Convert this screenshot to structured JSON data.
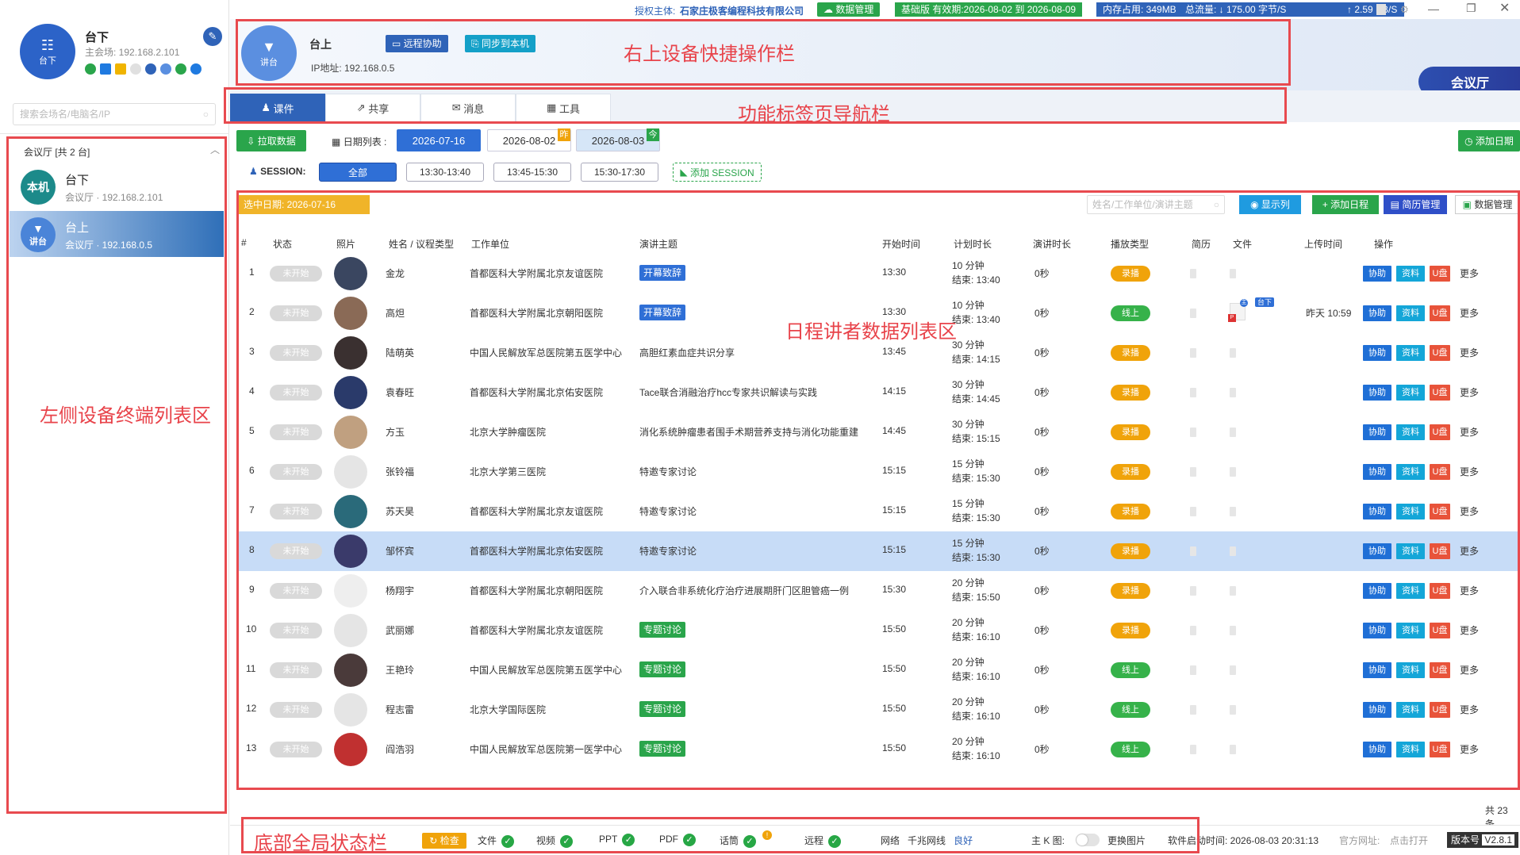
{
  "topbar": {
    "license_label": "授权主体:",
    "license_company": "石家庄极客编程科技有限公司",
    "data_mgmt": "数据管理",
    "edition": "基础版 有效期:2026-08-02 到 2026-08-09",
    "memory": "内存占用:   349MB",
    "traffic": "总流量:  ↓ 175.00 字节/S",
    "upload": "↑ 2.59 KB/S"
  },
  "left": {
    "host_name": "台下",
    "host_avatar_label": "台下",
    "host_sub": "主会场: 192.168.2.101",
    "search_placeholder": "搜索会场名/电脑名/IP",
    "group_title": "会议厅  [共 2 台]",
    "devices": [
      {
        "avatar": "本机",
        "name": "台下",
        "sub": "会议厅 · 192.168.2.101"
      },
      {
        "avatar": "讲台",
        "name": "台上",
        "sub": "会议厅 · 192.168.0.5"
      }
    ]
  },
  "header": {
    "device_avatar": "讲台",
    "device_name": "台上",
    "ip": "IP地址: 192.168.0.5",
    "remote_btn": "远程协助",
    "sync_btn": "同步到本机",
    "room_btn": "会议厅"
  },
  "tabs": [
    "课件",
    "共享",
    "消息",
    "工具"
  ],
  "daterow": {
    "pull_btn": "拉取数据",
    "date_list_label": "日期列表 :",
    "dates": [
      "2026-07-16",
      "2026-08-02",
      "2026-08-03"
    ],
    "date_badge_yesterday": "昨",
    "date_badge_today": "今",
    "add_date": "添加日期"
  },
  "session": {
    "label": "SESSION:",
    "chips": [
      "全部",
      "13:30-13:40",
      "13:45-15:30",
      "15:30-17:30"
    ],
    "add": "添加 SESSION"
  },
  "toolbar": {
    "selected_date": "选中日期:  2026-07-16",
    "search_placeholder": "姓名/工作单位/演讲主题",
    "show_cols": "显示列",
    "add_schedule": "添加日程",
    "resume_mgmt": "简历管理",
    "data_mgmt": "数据管理"
  },
  "table": {
    "headers": [
      "#",
      "状态",
      "照片",
      "姓名 / 议程类型",
      "工作单位",
      "演讲主题",
      "开始时间",
      "计划时长",
      "演讲时长",
      "播放类型",
      "简历",
      "文件",
      "上传时间",
      "操作"
    ],
    "rows": [
      {
        "n": "1",
        "status": "未开始",
        "name": "金龙",
        "org": "首都医科大学附属北京友谊医院",
        "topic": "开幕致辞",
        "topic_tag": true,
        "start": "13:30",
        "dur": "10 分钟",
        "end": "结束: 13:40",
        "speak": "0秒",
        "play": "录播",
        "play_color": "#f0a30a",
        "upload": ""
      },
      {
        "n": "2",
        "status": "未开始",
        "name": "高炟",
        "org": "首都医科大学附属北京朝阳医院",
        "topic": "开幕致辞",
        "topic_tag": true,
        "start": "13:30",
        "dur": "10 分钟",
        "end": "结束: 13:40",
        "speak": "0秒",
        "play": "线上",
        "play_color": "#36b24a",
        "upload": "昨天 10:59"
      },
      {
        "n": "3",
        "status": "未开始",
        "name": "陆萌英",
        "org": "中国人民解放军总医院第五医学中心",
        "topic": "高胆红素血症共识分享",
        "topic_tag": false,
        "start": "13:45",
        "dur": "30 分钟",
        "end": "结束: 14:15",
        "speak": "0秒",
        "play": "录播",
        "play_color": "#f0a30a",
        "upload": ""
      },
      {
        "n": "4",
        "status": "未开始",
        "name": "袁春旺",
        "org": "首都医科大学附属北京佑安医院",
        "topic": "Tace联合消融治疗hcc专家共识解读与实践",
        "topic_tag": false,
        "start": "14:15",
        "dur": "30 分钟",
        "end": "结束: 14:45",
        "speak": "0秒",
        "play": "录播",
        "play_color": "#f0a30a",
        "upload": ""
      },
      {
        "n": "5",
        "status": "未开始",
        "name": "方玉",
        "org": "北京大学肿瘤医院",
        "topic": "消化系统肿瘤患者围手术期营养支持与消化功能重建",
        "topic_tag": false,
        "start": "14:45",
        "dur": "30 分钟",
        "end": "结束: 15:15",
        "speak": "0秒",
        "play": "录播",
        "play_color": "#f0a30a",
        "upload": ""
      },
      {
        "n": "6",
        "status": "未开始",
        "name": "张铃福",
        "org": "北京大学第三医院",
        "topic": "特邀专家讨论",
        "topic_tag": false,
        "start": "15:15",
        "dur": "15 分钟",
        "end": "结束: 15:30",
        "speak": "0秒",
        "play": "录播",
        "play_color": "#f0a30a",
        "upload": ""
      },
      {
        "n": "7",
        "status": "未开始",
        "name": "苏天昊",
        "org": "首都医科大学附属北京友谊医院",
        "topic": "特邀专家讨论",
        "topic_tag": false,
        "start": "15:15",
        "dur": "15 分钟",
        "end": "结束: 15:30",
        "speak": "0秒",
        "play": "录播",
        "play_color": "#f0a30a",
        "upload": ""
      },
      {
        "n": "8",
        "status": "未开始",
        "name": "邹怀宾",
        "org": "首都医科大学附属北京佑安医院",
        "topic": "特邀专家讨论",
        "topic_tag": false,
        "start": "15:15",
        "dur": "15 分钟",
        "end": "结束: 15:30",
        "speak": "0秒",
        "play": "录播",
        "play_color": "#f0a30a",
        "upload": ""
      },
      {
        "n": "9",
        "status": "未开始",
        "name": "杨翔宇",
        "org": "首都医科大学附属北京朝阳医院",
        "topic": "介入联合非系统化疗治疗进展期肝门区胆管癌一例",
        "topic_tag": false,
        "start": "15:30",
        "dur": "20 分钟",
        "end": "结束: 15:50",
        "speak": "0秒",
        "play": "录播",
        "play_color": "#f0a30a",
        "upload": ""
      },
      {
        "n": "10",
        "status": "未开始",
        "name": "武丽娜",
        "org": "首都医科大学附属北京友谊医院",
        "topic": "专题讨论",
        "topic_tag": true,
        "start": "15:50",
        "dur": "20 分钟",
        "end": "结束: 16:10",
        "speak": "0秒",
        "play": "录播",
        "play_color": "#f0a30a",
        "upload": ""
      },
      {
        "n": "11",
        "status": "未开始",
        "name": "王艳玲",
        "org": "中国人民解放军总医院第五医学中心",
        "topic": "专题讨论",
        "topic_tag": true,
        "start": "15:50",
        "dur": "20 分钟",
        "end": "结束: 16:10",
        "speak": "0秒",
        "play": "线上",
        "play_color": "#36b24a",
        "upload": ""
      },
      {
        "n": "12",
        "status": "未开始",
        "name": "程志雷",
        "org": "北京大学国际医院",
        "topic": "专题讨论",
        "topic_tag": true,
        "start": "15:50",
        "dur": "20 分钟",
        "end": "结束: 16:10",
        "speak": "0秒",
        "play": "线上",
        "play_color": "#36b24a",
        "upload": ""
      },
      {
        "n": "13",
        "status": "未开始",
        "name": "阎浩羽",
        "org": "中国人民解放军总医院第一医学中心",
        "topic": "专题讨论",
        "topic_tag": true,
        "start": "15:50",
        "dur": "20 分钟",
        "end": "结束: 16:10",
        "speak": "0秒",
        "play": "线上",
        "play_color": "#36b24a",
        "upload": ""
      }
    ],
    "ops": {
      "assist": "协助",
      "material": "资料",
      "udisk": "U盘",
      "more": "更多"
    },
    "file_badge": "台下",
    "file_badge_small": "主",
    "total": "共 23 条"
  },
  "bottom": {
    "check": "检查",
    "file": "文件",
    "video": "视频",
    "ppt": "PPT",
    "pdf": "PDF",
    "speech": "话筒",
    "speech_warn": "!",
    "remote": "远程",
    "net": "网络",
    "net_type": "千兆网线",
    "net_status": "良好",
    "kline": "主 K 图:",
    "replace_img": "更换图片",
    "start_time": "软件启动时间:  2026-08-03 20:31:13",
    "official": "官方网址:",
    "official_link": "点击打开",
    "version_label": "版本号",
    "version": "V2.8.1"
  },
  "annotations": {
    "top_bar": "右上设备快捷操作栏",
    "tabs": "功能标签页导航栏",
    "table": "日程讲者数据列表区",
    "left": "左侧设备终端列表区",
    "bottom": "底部全局状态栏"
  },
  "colors": {
    "primary": "#2f63b8",
    "green": "#2aa54b",
    "orange": "#f0a30a",
    "blue": "#1f7ae0",
    "red": "#e8434a"
  }
}
